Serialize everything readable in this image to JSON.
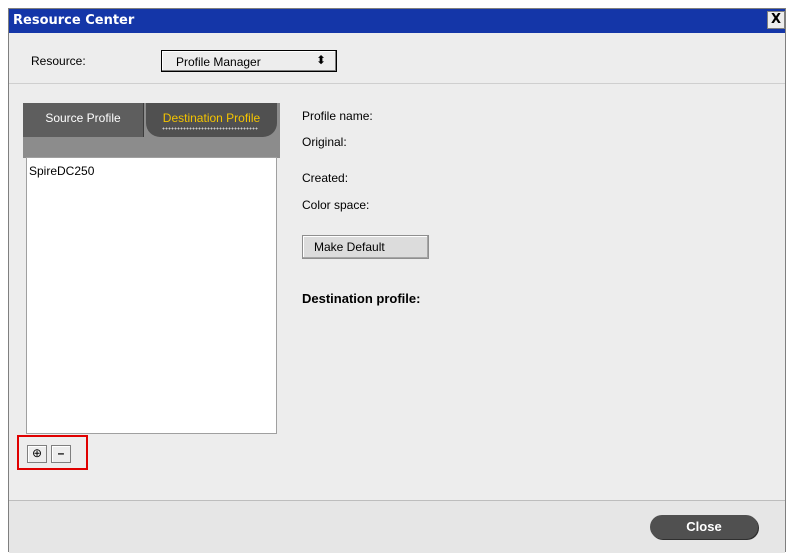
{
  "window": {
    "title": "Resource Center",
    "close_glyph": "X"
  },
  "resource": {
    "label": "Resource:",
    "selected": "Profile Manager",
    "arrows": "⬍"
  },
  "tabs": [
    {
      "label": "Source Profile"
    },
    {
      "label": "Destination Profile"
    }
  ],
  "profiles": {
    "items": [
      "SpireDC250"
    ]
  },
  "list_buttons": {
    "add_glyph": "⊕",
    "remove_glyph": "–"
  },
  "details": {
    "profile_name_label": "Profile name:",
    "original_label": "Original:",
    "created_label": "Created:",
    "color_space_label": "Color space:"
  },
  "make_default_label": "Make Default",
  "destination_profile_label": "Destination profile:",
  "footer": {
    "close_label": "Close"
  },
  "colors": {
    "title_bar": "#1436a8",
    "active_tab_text": "#f4c400",
    "highlight": "#e00000"
  }
}
